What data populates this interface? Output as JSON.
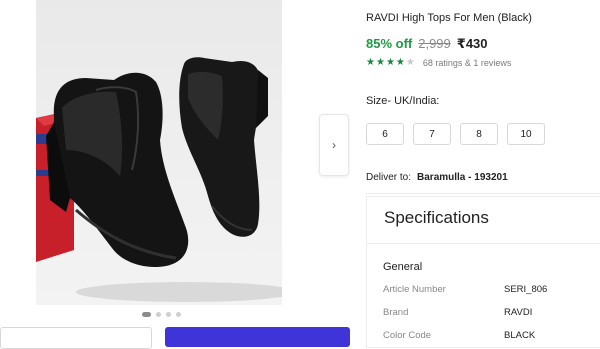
{
  "product": {
    "title": "RAVDI High Tops For Men (Black)",
    "discount": "85% off",
    "mrp": "2,999",
    "price": "₹430",
    "rating_value": 4,
    "rating_text": "68 ratings  & 1 reviews"
  },
  "gallery": {
    "image_alt": "Black leather chelsea boots",
    "dot_count": 4,
    "active_dot": 0,
    "next_icon": "chevron-right-icon"
  },
  "sizes": {
    "label": "Size- UK/India:",
    "options": [
      "6",
      "7",
      "8",
      "10"
    ]
  },
  "delivery": {
    "label": "Deliver to:",
    "location": "Baramulla - 193201"
  },
  "specifications": {
    "heading": "Specifications",
    "section": "General",
    "rows": [
      {
        "key": "Article Number",
        "value": "SERI_806"
      },
      {
        "key": "Brand",
        "value": "RAVDI"
      },
      {
        "key": "Color Code",
        "value": "BLACK"
      }
    ]
  },
  "colors": {
    "discount_green": "#1e9a45",
    "star_green": "#138a3c",
    "button_blue": "#3f34d8"
  }
}
